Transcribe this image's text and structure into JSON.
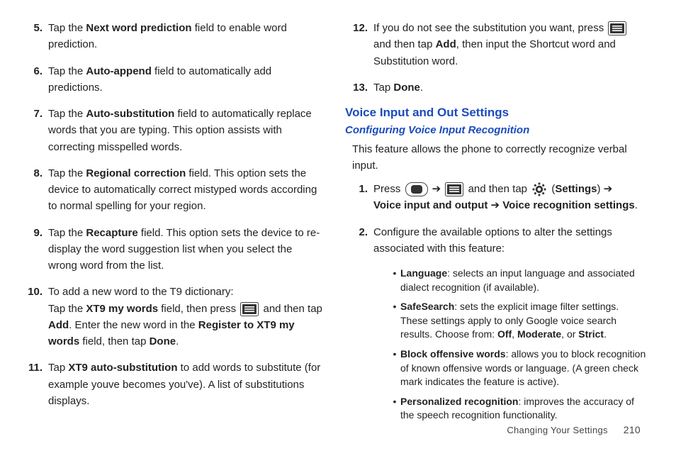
{
  "left": {
    "items": [
      {
        "n": "5.",
        "parts": [
          "Tap the ",
          [
            "b",
            "Next word prediction"
          ],
          " field to enable word prediction."
        ]
      },
      {
        "n": "6.",
        "parts": [
          "Tap the ",
          [
            "b",
            "Auto-append"
          ],
          " field to automatically add predictions."
        ]
      },
      {
        "n": "7.",
        "parts": [
          "Tap the ",
          [
            "b",
            "Auto-substitution"
          ],
          " field to automatically replace words that you are typing. This option assists with correcting misspelled words."
        ]
      },
      {
        "n": "8.",
        "parts": [
          "Tap the ",
          [
            "b",
            "Regional correction"
          ],
          " field. This option sets the device to automatically correct mistyped words according to normal spelling for your region."
        ]
      },
      {
        "n": "9.",
        "parts": [
          "Tap the ",
          [
            "b",
            "Recapture"
          ],
          " field. This option sets the device to re-display the word suggestion list when you select the wrong word from the list."
        ]
      },
      {
        "n": "10.",
        "parts": [
          "To add a new word to the T9 dictionary:",
          [
            "br"
          ],
          "Tap the ",
          [
            "b",
            "XT9 my words"
          ],
          " field, then press ",
          [
            "icon",
            "menu-icon"
          ],
          " and then tap ",
          [
            "b",
            "Add"
          ],
          ". Enter the new word in the ",
          [
            "b",
            "Register to XT9 my words"
          ],
          " field, then tap ",
          [
            "b",
            "Done"
          ],
          "."
        ]
      },
      {
        "n": "11.",
        "parts": [
          "Tap ",
          [
            "b",
            "XT9 auto-substitution"
          ],
          " to add words to substitute (for example youve becomes you've). A list of substitutions displays."
        ]
      }
    ]
  },
  "right": {
    "items12_13": [
      {
        "n": "12.",
        "parts": [
          "If you do not see the substitution you want, press ",
          [
            "icon",
            "menu-icon"
          ],
          " and then tap ",
          [
            "b",
            "Add"
          ],
          ", then input the Shortcut word and Substitution word."
        ]
      },
      {
        "n": "13.",
        "parts": [
          "Tap ",
          [
            "b",
            "Done"
          ],
          "."
        ]
      }
    ],
    "h1": "Voice Input and Out Settings",
    "h2": "Configuring Voice Input Recognition",
    "intro": "This feature allows the phone to correctly recognize verbal input.",
    "voice_items": [
      {
        "n": "1.",
        "parts": [
          "Press ",
          [
            "icon",
            "home-icon"
          ],
          " ➔ ",
          [
            "icon",
            "menu-icon"
          ],
          " and then tap ",
          [
            "icon",
            "gear-icon"
          ],
          " (",
          [
            "b",
            "Settings"
          ],
          ") ➔ ",
          [
            "br"
          ],
          [
            "b",
            "Voice input and output"
          ],
          " ➔ ",
          [
            "b",
            "Voice recognition settings"
          ],
          "."
        ]
      },
      {
        "n": "2.",
        "parts": [
          "Configure the available options to alter the settings associated with this feature:"
        ]
      }
    ],
    "bullets": [
      {
        "parts": [
          [
            "b",
            "Language"
          ],
          ": selects an input language and associated dialect recognition (if available)."
        ]
      },
      {
        "parts": [
          [
            "b",
            "SafeSearch"
          ],
          ": sets the explicit image filter settings. These settings apply to only Google voice search results. Choose from: ",
          [
            "b",
            "Off"
          ],
          ", ",
          [
            "b",
            "Moderate"
          ],
          ", or ",
          [
            "b",
            "Strict"
          ],
          "."
        ]
      },
      {
        "parts": [
          [
            "b",
            "Block offensive words"
          ],
          ": allows you to block recognition of known offensive words or language. (A green check mark indicates the feature is active)."
        ]
      },
      {
        "parts": [
          [
            "b",
            "Personalized recognition"
          ],
          ": improves the accuracy of the speech recognition functionality."
        ]
      }
    ]
  },
  "footer": {
    "section": "Changing Your Settings",
    "page": "210"
  }
}
